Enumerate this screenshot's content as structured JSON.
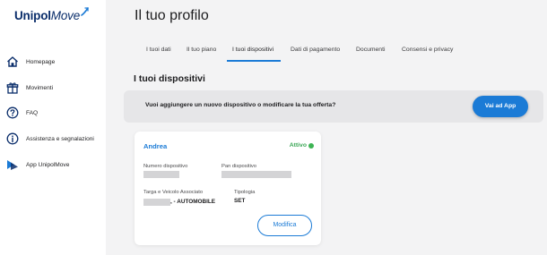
{
  "logo": {
    "part1": "Unipol",
    "part2": "Move"
  },
  "sidebar": {
    "items": [
      {
        "label": "Homepage",
        "icon": "home-icon"
      },
      {
        "label": "Movimenti",
        "icon": "gift-icon"
      },
      {
        "label": "FAQ",
        "icon": "question-icon"
      },
      {
        "label": "Assistenza e segnalazioni",
        "icon": "info-icon"
      },
      {
        "label": "App UnipolMove",
        "icon": "app-icon"
      }
    ]
  },
  "page": {
    "title": "Il tuo profilo"
  },
  "tabs": [
    {
      "label": "I tuoi dati"
    },
    {
      "label": "Il tuo piano"
    },
    {
      "label": "I tuoi dispositivi",
      "active": true
    },
    {
      "label": "Dati di pagamento"
    },
    {
      "label": "Documenti"
    },
    {
      "label": "Consensi e privacy"
    }
  ],
  "section": {
    "title": "I tuoi dispositivi"
  },
  "banner": {
    "text": "Vuoi aggiungere un nuovo dispositivo o modificare la tua offerta?",
    "button": "Vai ad App"
  },
  "device": {
    "name": "Andrea",
    "status": "Attivo",
    "numero_label": "Numero dispositivo",
    "pan_label": "Pan dispositivo",
    "targa_label": "Targa e Veicolo Associato",
    "targa_value": ", - AUTOMOBILE",
    "tipologia_label": "Tipologia",
    "tipologia_value": "SET",
    "button": "Modifica"
  },
  "colors": {
    "accent": "#1b7bd6",
    "status_active": "#3db454",
    "logo": "#0b2e6b"
  }
}
